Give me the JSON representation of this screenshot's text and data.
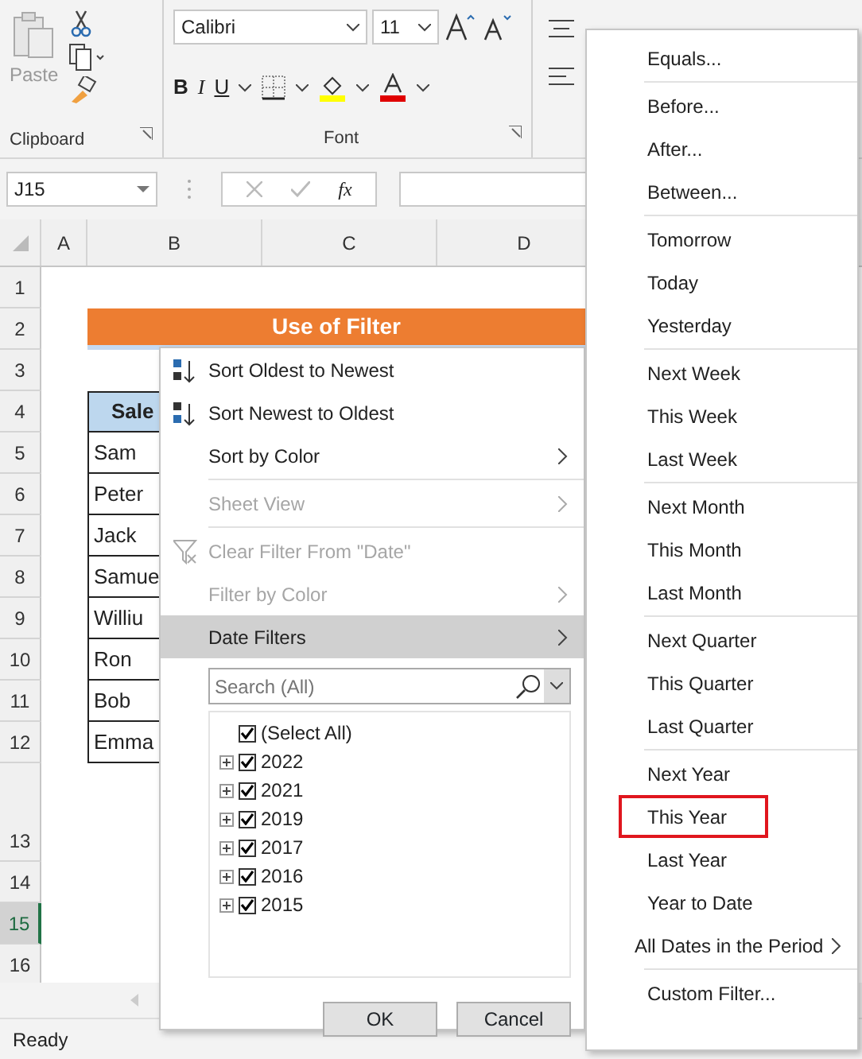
{
  "ribbon": {
    "clipboard": {
      "paste_label": "Paste",
      "group_label": "Clipboard"
    },
    "font": {
      "font_name": "Calibri",
      "font_size": "11",
      "bold_label": "B",
      "italic_label": "I",
      "underline_label": "U",
      "group_label": "Font"
    }
  },
  "formula_bar": {
    "name_box": "J15",
    "fx_label": "fx"
  },
  "columns": [
    {
      "label": "A"
    },
    {
      "label": "B"
    },
    {
      "label": "C"
    },
    {
      "label": "D"
    }
  ],
  "rows": [
    {
      "label": "1",
      "selected": false
    },
    {
      "label": "2",
      "selected": false
    },
    {
      "label": "3",
      "selected": false
    },
    {
      "label": "4",
      "selected": false
    },
    {
      "label": "5",
      "selected": false
    },
    {
      "label": "6",
      "selected": false
    },
    {
      "label": "7",
      "selected": false
    },
    {
      "label": "8",
      "selected": false
    },
    {
      "label": "9",
      "selected": false
    },
    {
      "label": "10",
      "selected": false
    },
    {
      "label": "11",
      "selected": false
    },
    {
      "label": "12",
      "selected": false
    },
    {
      "label": "13",
      "selected": false
    },
    {
      "label": "14",
      "selected": false
    },
    {
      "label": "15",
      "selected": true
    },
    {
      "label": "16",
      "selected": false
    }
  ],
  "sheet": {
    "title": "Use of Filter",
    "header": "Sale",
    "names": [
      "Sam",
      "Peter",
      "Jack",
      "Samue",
      "Williu",
      "Ron",
      "Bob",
      "Emma"
    ]
  },
  "filter_menu": {
    "groups": [
      [
        {
          "kind": "sort_asc",
          "label": "Sort Oldest to Newest",
          "disabled": false,
          "submenu": false,
          "selected": false
        },
        {
          "kind": "sort_desc",
          "label": "Sort Newest to Oldest",
          "disabled": false,
          "submenu": false,
          "selected": false
        },
        {
          "kind": "plain",
          "label": "Sort by Color",
          "disabled": false,
          "submenu": true,
          "selected": false
        }
      ],
      [
        {
          "kind": "plain",
          "label": "Sheet View",
          "disabled": true,
          "submenu": true,
          "selected": false
        }
      ],
      [
        {
          "kind": "clear",
          "label": "Clear Filter From \"Date\"",
          "disabled": true,
          "submenu": false,
          "selected": false
        },
        {
          "kind": "plain",
          "label": "Filter by Color",
          "disabled": true,
          "submenu": true,
          "selected": false
        },
        {
          "kind": "plain",
          "label": "Date Filters",
          "disabled": false,
          "submenu": true,
          "selected": true
        }
      ]
    ],
    "search": {
      "placeholder": "Search (All)"
    },
    "tree": [
      {
        "kind": "all",
        "label": "(Select All)",
        "checked": true
      },
      {
        "kind": "year",
        "label": "2022",
        "checked": true
      },
      {
        "kind": "year",
        "label": "2021",
        "checked": true
      },
      {
        "kind": "year",
        "label": "2019",
        "checked": true
      },
      {
        "kind": "year",
        "label": "2017",
        "checked": true
      },
      {
        "kind": "year",
        "label": "2016",
        "checked": true
      },
      {
        "kind": "year",
        "label": "2015",
        "checked": true
      }
    ],
    "buttons": [
      "OK",
      "Cancel"
    ]
  },
  "date_filters": {
    "groups": [
      [
        {
          "label": "Equals...",
          "highlighted": false,
          "submenu": false
        }
      ],
      [
        {
          "label": "Before...",
          "highlighted": false,
          "submenu": false
        },
        {
          "label": "After...",
          "highlighted": false,
          "submenu": false
        },
        {
          "label": "Between...",
          "highlighted": false,
          "submenu": false
        }
      ],
      [
        {
          "label": "Tomorrow",
          "highlighted": false,
          "submenu": false
        },
        {
          "label": "Today",
          "highlighted": false,
          "submenu": false
        },
        {
          "label": "Yesterday",
          "highlighted": false,
          "submenu": false
        }
      ],
      [
        {
          "label": "Next Week",
          "highlighted": false,
          "submenu": false
        },
        {
          "label": "This Week",
          "highlighted": false,
          "submenu": false
        },
        {
          "label": "Last Week",
          "highlighted": false,
          "submenu": false
        }
      ],
      [
        {
          "label": "Next Month",
          "highlighted": false,
          "submenu": false
        },
        {
          "label": "This Month",
          "highlighted": false,
          "submenu": false
        },
        {
          "label": "Last Month",
          "highlighted": false,
          "submenu": false
        }
      ],
      [
        {
          "label": "Next Quarter",
          "highlighted": false,
          "submenu": false
        },
        {
          "label": "This Quarter",
          "highlighted": false,
          "submenu": false
        },
        {
          "label": "Last Quarter",
          "highlighted": false,
          "submenu": false
        }
      ],
      [
        {
          "label": "Next Year",
          "highlighted": false,
          "submenu": false
        },
        {
          "label": "This Year",
          "highlighted": true,
          "submenu": false
        },
        {
          "label": "Last Year",
          "highlighted": false,
          "submenu": false
        },
        {
          "label": "Year to Date",
          "highlighted": false,
          "submenu": false
        },
        {
          "label": "All Dates in the Period",
          "highlighted": false,
          "submenu": true
        }
      ],
      [
        {
          "label": "Custom Filter...",
          "highlighted": false,
          "submenu": false
        }
      ]
    ]
  },
  "status_bar": {
    "text": "Ready"
  }
}
